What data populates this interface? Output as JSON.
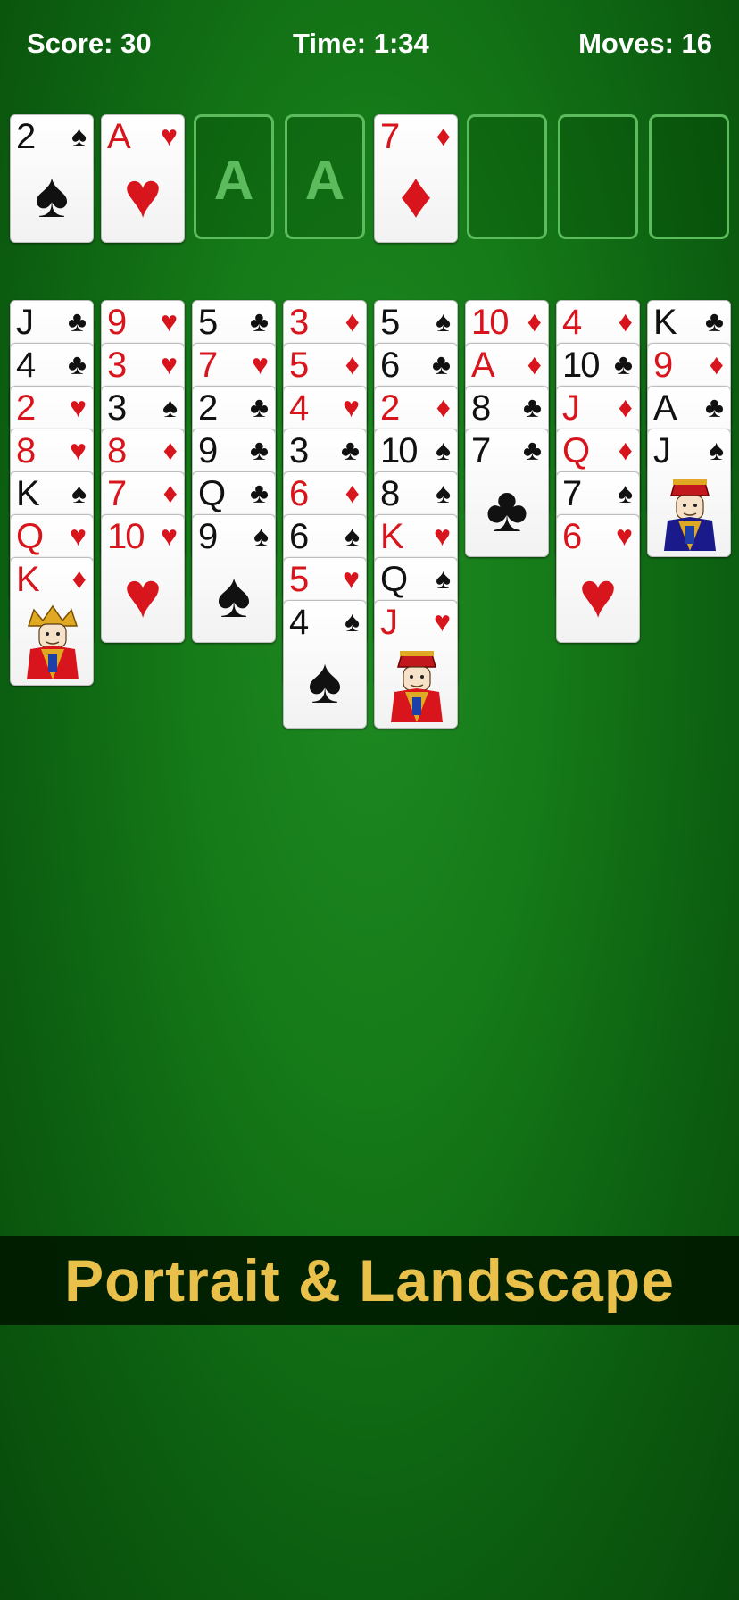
{
  "hud": {
    "score": "Score: 30",
    "time": "Time: 1:34",
    "moves": "Moves: 16"
  },
  "top_row": {
    "free_cells": [
      {
        "rank": "2",
        "suit": "♠",
        "color": "black"
      },
      {
        "rank": "A",
        "suit": "♥",
        "color": "red"
      }
    ],
    "foundations": [
      {
        "placeholder": "A"
      },
      {
        "placeholder": "A"
      },
      {
        "rank": "7",
        "suit": "♦",
        "color": "red"
      },
      {
        "placeholder": ""
      },
      {
        "placeholder": ""
      },
      {
        "placeholder": ""
      }
    ]
  },
  "tableau": [
    [
      {
        "rank": "J",
        "suit": "♣"
      },
      {
        "rank": "4",
        "suit": "♣"
      },
      {
        "rank": "2",
        "suit": "♥"
      },
      {
        "rank": "8",
        "suit": "♥"
      },
      {
        "rank": "K",
        "suit": "♠"
      },
      {
        "rank": "Q",
        "suit": "♥"
      },
      {
        "rank": "K",
        "suit": "♦",
        "face": "king"
      }
    ],
    [
      {
        "rank": "9",
        "suit": "♥"
      },
      {
        "rank": "3",
        "suit": "♥"
      },
      {
        "rank": "3",
        "suit": "♠"
      },
      {
        "rank": "8",
        "suit": "♦"
      },
      {
        "rank": "7",
        "suit": "♦"
      },
      {
        "rank": "10",
        "suit": "♥"
      }
    ],
    [
      {
        "rank": "5",
        "suit": "♣"
      },
      {
        "rank": "7",
        "suit": "♥"
      },
      {
        "rank": "2",
        "suit": "♣"
      },
      {
        "rank": "9",
        "suit": "♣"
      },
      {
        "rank": "Q",
        "suit": "♣"
      },
      {
        "rank": "9",
        "suit": "♠"
      }
    ],
    [
      {
        "rank": "3",
        "suit": "♦"
      },
      {
        "rank": "5",
        "suit": "♦"
      },
      {
        "rank": "4",
        "suit": "♥"
      },
      {
        "rank": "3",
        "suit": "♣"
      },
      {
        "rank": "6",
        "suit": "♦"
      },
      {
        "rank": "6",
        "suit": "♠"
      },
      {
        "rank": "5",
        "suit": "♥"
      },
      {
        "rank": "4",
        "suit": "♠"
      }
    ],
    [
      {
        "rank": "5",
        "suit": "♠"
      },
      {
        "rank": "6",
        "suit": "♣"
      },
      {
        "rank": "2",
        "suit": "♦"
      },
      {
        "rank": "10",
        "suit": "♠"
      },
      {
        "rank": "8",
        "suit": "♠"
      },
      {
        "rank": "K",
        "suit": "♥"
      },
      {
        "rank": "Q",
        "suit": "♠"
      },
      {
        "rank": "J",
        "suit": "♥",
        "face": "jack"
      }
    ],
    [
      {
        "rank": "10",
        "suit": "♦"
      },
      {
        "rank": "A",
        "suit": "♦"
      },
      {
        "rank": "8",
        "suit": "♣"
      },
      {
        "rank": "7",
        "suit": "♣"
      }
    ],
    [
      {
        "rank": "4",
        "suit": "♦"
      },
      {
        "rank": "10",
        "suit": "♣"
      },
      {
        "rank": "J",
        "suit": "♦"
      },
      {
        "rank": "Q",
        "suit": "♦"
      },
      {
        "rank": "7",
        "suit": "♠"
      },
      {
        "rank": "6",
        "suit": "♥"
      }
    ],
    [
      {
        "rank": "K",
        "suit": "♣"
      },
      {
        "rank": "9",
        "suit": "♦"
      },
      {
        "rank": "A",
        "suit": "♣"
      },
      {
        "rank": "J",
        "suit": "♠",
        "face": "jack"
      }
    ]
  ],
  "banner": {
    "text": "Portrait & Landscape"
  },
  "colors": {
    "felt": "#157a18",
    "red_suit": "#d8141c",
    "black_suit": "#111111",
    "banner_text": "#e8c04a",
    "slot_outline": "#5cbb5c"
  }
}
